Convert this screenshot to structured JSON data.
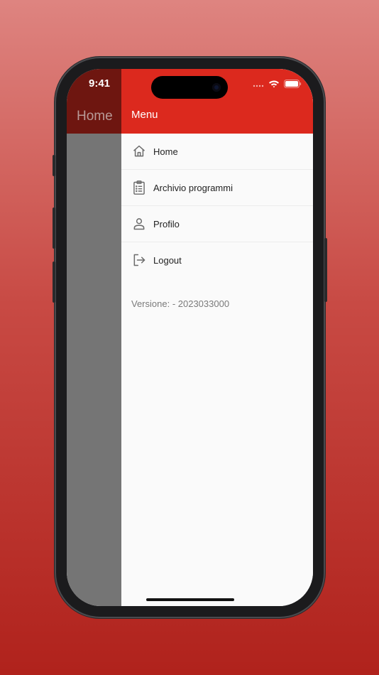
{
  "status_bar": {
    "time": "9:41"
  },
  "background_screen": {
    "title": "Home"
  },
  "drawer": {
    "title": "Menu",
    "items": [
      {
        "label": "Home",
        "icon": "home-icon"
      },
      {
        "label": "Archivio programmi",
        "icon": "clipboard-list-icon"
      },
      {
        "label": "Profilo",
        "icon": "person-icon"
      },
      {
        "label": "Logout",
        "icon": "logout-icon"
      }
    ],
    "version_text": "Versione:  - 2023033000"
  },
  "colors": {
    "brand_red": "#dc291e",
    "dimmed_bar": "#6e1610",
    "scrim": "#757575",
    "drawer_bg": "#fafafa"
  }
}
